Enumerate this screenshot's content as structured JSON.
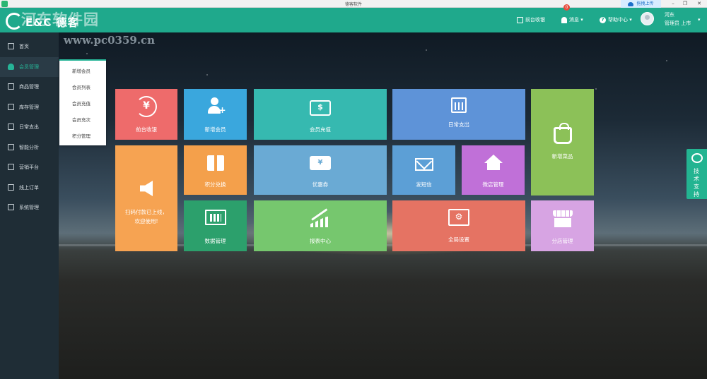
{
  "window": {
    "title": "德客软件",
    "upload_button": "拖拽上传"
  },
  "watermark": {
    "title": "河东软件园",
    "url": "www.pc0359.cn"
  },
  "header": {
    "brand": "E&C 德客",
    "front_register": "前台收银",
    "messages": "消息",
    "message_badge": "0",
    "help_center": "帮助中心",
    "user_name": "河东",
    "user_role": "管理员  上市"
  },
  "sidebar": {
    "items": [
      {
        "label": "首页"
      },
      {
        "label": "会员管理"
      },
      {
        "label": "商品管理"
      },
      {
        "label": "库存管理"
      },
      {
        "label": "日常支出"
      },
      {
        "label": "智能分析"
      },
      {
        "label": "营销平台"
      },
      {
        "label": "线上订单"
      },
      {
        "label": "系统管理"
      }
    ]
  },
  "submenu": {
    "items": [
      {
        "label": "新增会员"
      },
      {
        "label": "会员列表"
      },
      {
        "label": "会员充值"
      },
      {
        "label": "会员充次"
      },
      {
        "label": "积分管理"
      }
    ]
  },
  "tiles": {
    "front_register": {
      "label": "前台收银",
      "color": "#ee6b6b",
      "glyph": "¥"
    },
    "add_member": {
      "label": "新增会员",
      "color": "#3aa7dd"
    },
    "member_recharge": {
      "label": "会员充值",
      "color": "#36b9b0",
      "glyph": "$"
    },
    "daily_expense": {
      "label": "日常支出",
      "color": "#5e93d8"
    },
    "add_product": {
      "label": "新增菜品",
      "color": "#8cc158"
    },
    "scan_pay": {
      "line1": "扫码付款已上线，",
      "line2": "欢迎使用!",
      "color": "#f6a352"
    },
    "points_exchange": {
      "label": "积分兑换",
      "color": "#f4a04b"
    },
    "coupon": {
      "label": "优惠券",
      "color": "#6aaad4",
      "glyph": "¥"
    },
    "send_sms": {
      "label": "发短信",
      "color": "#5c9fd6"
    },
    "wechat_shop": {
      "label": "微店管理",
      "color": "#c070d8"
    },
    "data_manage": {
      "label": "数据管理",
      "color": "#2ca06c"
    },
    "report_center": {
      "label": "报表中心",
      "color": "#76c76e"
    },
    "global_settings": {
      "label": "全局设置",
      "color": "#e57363",
      "glyph": "⚙"
    },
    "branch_manage": {
      "label": "分店管理",
      "color": "#d7a4e3"
    }
  },
  "support": {
    "text": "技术支持"
  }
}
